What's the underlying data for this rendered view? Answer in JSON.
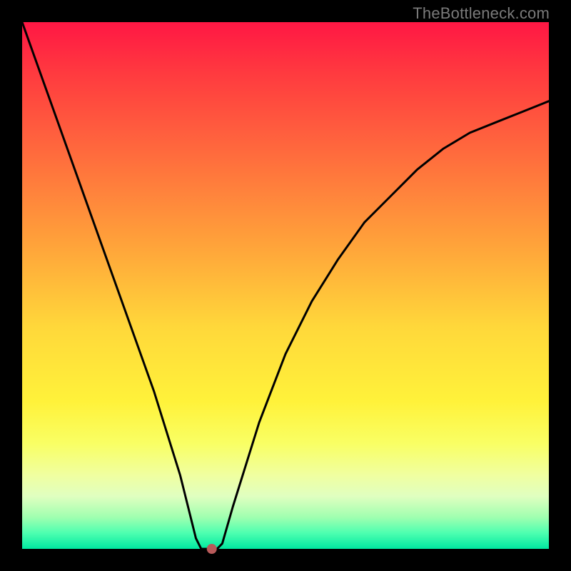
{
  "watermark": "TheBottleneck.com",
  "chart_data": {
    "type": "line",
    "title": "",
    "xlabel": "",
    "ylabel": "",
    "xlim": [
      0,
      100
    ],
    "ylim": [
      0,
      100
    ],
    "grid": false,
    "legend": false,
    "series": [
      {
        "name": "bottleneck-curve",
        "color": "#000000",
        "x": [
          0,
          5,
          10,
          15,
          20,
          25,
          30,
          33,
          34,
          35,
          37,
          38,
          40,
          45,
          50,
          55,
          60,
          65,
          70,
          75,
          80,
          85,
          90,
          95,
          100
        ],
        "y": [
          100,
          86,
          72,
          58,
          44,
          30,
          14,
          2,
          0,
          0,
          0,
          1,
          8,
          24,
          37,
          47,
          55,
          62,
          67,
          72,
          76,
          79,
          81,
          83,
          85
        ]
      }
    ],
    "marker": {
      "name": "optimal-point",
      "x": 36,
      "y": 0,
      "color": "#b85a5a",
      "radius_px": 7
    },
    "colors": {
      "gradient_top": "#ff1744",
      "gradient_bottom": "#00e8a0",
      "frame": "#000000"
    }
  }
}
